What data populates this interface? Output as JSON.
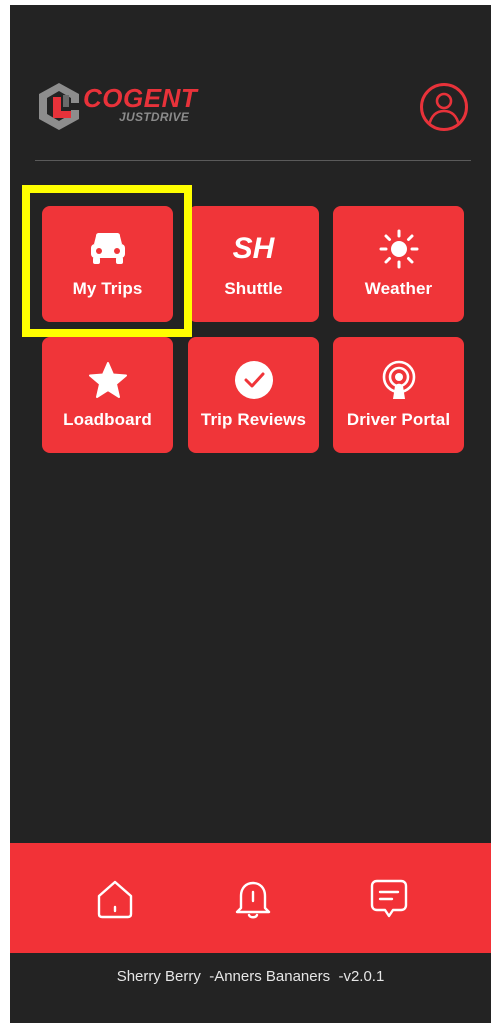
{
  "brand": {
    "name": "COGENT",
    "tagline": "JUSTDRIVE",
    "accent_color": "#f03539"
  },
  "header": {
    "profile_icon": "user-avatar-icon"
  },
  "tiles": [
    {
      "label": "My Trips",
      "icon": "car-icon"
    },
    {
      "label": "Shuttle",
      "icon": "sh-text-icon",
      "icon_text": "SH"
    },
    {
      "label": "Weather",
      "icon": "sun-icon"
    },
    {
      "label": "Loadboard",
      "icon": "star-icon"
    },
    {
      "label": "Trip Reviews",
      "icon": "check-circle-icon"
    },
    {
      "label": "Driver Portal",
      "icon": "podcast-icon"
    }
  ],
  "bottom_nav": [
    {
      "name": "home",
      "icon": "home-icon"
    },
    {
      "name": "notifications",
      "icon": "bell-icon"
    },
    {
      "name": "messages",
      "icon": "message-icon"
    }
  ],
  "footer": {
    "text": "Sherry Berry  -Anners Bananers  -v2.0.1"
  }
}
